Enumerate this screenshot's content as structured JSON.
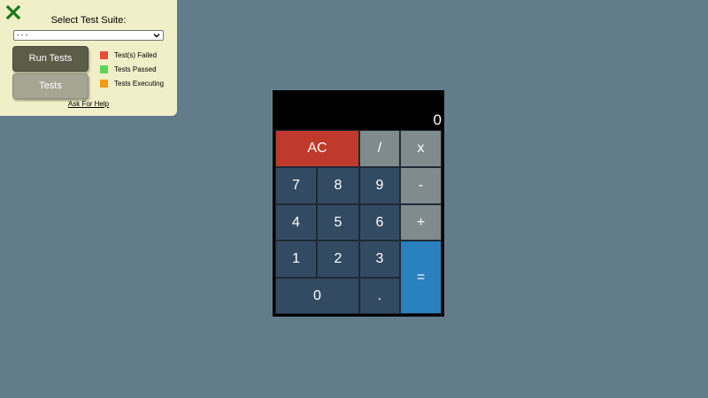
{
  "panel": {
    "title": "Select Test Suite:",
    "select_value": "- - -",
    "run_button": "Run Tests",
    "tests_button": "Tests",
    "help_link": "Ask For Help",
    "legend": [
      {
        "label": "Test(s) Failed",
        "color": "#e74c3c"
      },
      {
        "label": "Tests Passed",
        "color": "#5fd35a"
      },
      {
        "label": "Tests Executing",
        "color": "#f39c12"
      }
    ],
    "close_icon_color": "#1a7a1a"
  },
  "calculator": {
    "display": "0",
    "keys": {
      "ac": "AC",
      "divide": "/",
      "multiply": "x",
      "seven": "7",
      "eight": "8",
      "nine": "9",
      "subtract": "-",
      "four": "4",
      "five": "5",
      "six": "6",
      "add": "+",
      "one": "1",
      "two": "2",
      "three": "3",
      "equals": "=",
      "zero": "0",
      "decimal": "."
    }
  }
}
